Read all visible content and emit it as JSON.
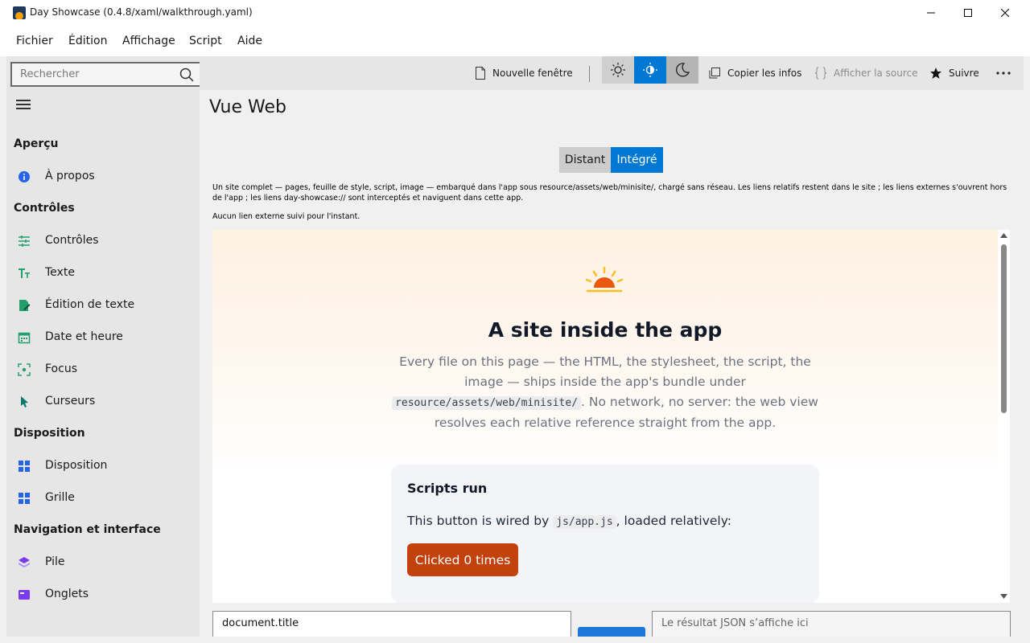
{
  "window": {
    "title": "Day Showcase (0.4.8/xaml/walkthrough.yaml)"
  },
  "menu": [
    "Fichier",
    "Édition",
    "Affichage",
    "Script",
    "Aide"
  ],
  "search": {
    "placeholder": "Rechercher"
  },
  "toolbar": {
    "new_window": "Nouvelle fenêtre",
    "copy_info": "Copier les infos",
    "show_source": "Afficher la source",
    "follow": "Suivre",
    "themes": [
      "light",
      "auto",
      "dark"
    ],
    "active_theme": "auto"
  },
  "sidebar": {
    "sections": [
      {
        "title": "Aperçu",
        "items": [
          {
            "label": "À propos",
            "icon": "info-icon"
          }
        ]
      },
      {
        "title": "Contrôles",
        "items": [
          {
            "label": "Contrôles",
            "icon": "sliders-icon"
          },
          {
            "label": "Texte",
            "icon": "text-icon"
          },
          {
            "label": "Édition de texte",
            "icon": "edit-icon"
          },
          {
            "label": "Date et heure",
            "icon": "calendar-icon"
          },
          {
            "label": "Focus",
            "icon": "focus-icon"
          },
          {
            "label": "Curseurs",
            "icon": "cursor-icon"
          }
        ]
      },
      {
        "title": "Disposition",
        "items": [
          {
            "label": "Disposition",
            "icon": "layout-icon"
          },
          {
            "label": "Grille",
            "icon": "grid-icon"
          }
        ]
      },
      {
        "title": "Navigation et interface",
        "items": [
          {
            "label": "Pile",
            "icon": "stack-icon"
          },
          {
            "label": "Onglets",
            "icon": "tabs-icon"
          }
        ]
      }
    ]
  },
  "page": {
    "title": "Vue Web",
    "tabs": [
      "Distant",
      "Intégré"
    ],
    "selected_tab": "Intégré",
    "description": "Un site complet — pages, feuille de style, script, image — embarqué dans l'app sous resource/assets/web/minisite/, chargé sans réseau. Les liens relatifs restent dans le site ; les liens externes s'ouvrent hors de l'app ; les liens day-showcase:// sont interceptés et naviguent dans cette app.",
    "status": "Aucun lien externe suivi pour l'instant."
  },
  "webview": {
    "title": "A site inside the app",
    "para_a": "Every file on this page — the HTML, the stylesheet, the script, the image — ships inside the app's bundle under ",
    "para_code": "resource/assets/web/minisite/",
    "para_b": ". No network, no server: the web view resolves each relative reference straight from the app.",
    "card": {
      "title": "Scripts run",
      "text_a": "This button is wired by ",
      "text_code": "js/app.js",
      "text_b": ", loaded relatively:",
      "button": "Clicked 0 times"
    }
  },
  "console": {
    "input_value": "document.title",
    "output_placeholder": "Le résultat JSON s’affiche ici"
  },
  "colors": {
    "accent": "#0078d4",
    "site_button": "#c2410c"
  }
}
